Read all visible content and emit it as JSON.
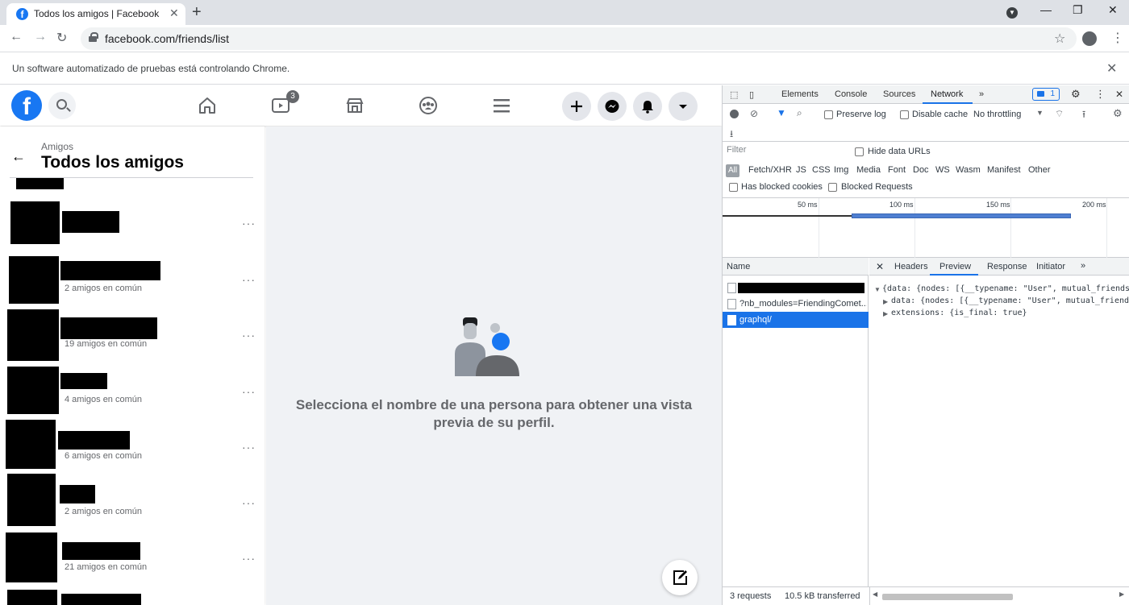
{
  "browser": {
    "tab_title": "Todos los amigos | Facebook",
    "url": "facebook.com/friends/list",
    "infobar_message": "Un software automatizado de pruebas está controlando Chrome."
  },
  "facebook": {
    "watch_badge": "3",
    "breadcrumb": "Amigos",
    "list_title": "Todos los amigos",
    "friends": [
      {
        "mutual": ""
      },
      {
        "mutual": "2 amigos en común"
      },
      {
        "mutual": "19 amigos en común"
      },
      {
        "mutual": "4 amigos en común"
      },
      {
        "mutual": "6 amigos en común"
      },
      {
        "mutual": "2 amigos en común"
      },
      {
        "mutual": "21 amigos en común"
      }
    ],
    "more_options": "···",
    "empty_state": "Selecciona el nombre de una persona para obtener una vista previa de su perfil."
  },
  "devtools": {
    "tabs": [
      "Elements",
      "Console",
      "Sources",
      "Network"
    ],
    "active_tab": "Network",
    "issues_count": "1",
    "preserve_log": "Preserve log",
    "disable_cache": "Disable cache",
    "throttling": "No throttling",
    "filter_placeholder": "Filter",
    "hide_data_urls": "Hide data URLs",
    "type_filters": [
      "All",
      "Fetch/XHR",
      "JS",
      "CSS",
      "Img",
      "Media",
      "Font",
      "Doc",
      "WS",
      "Wasm",
      "Manifest",
      "Other"
    ],
    "has_blocked_cookies": "Has blocked cookies",
    "blocked_requests": "Blocked Requests",
    "timeline_ticks": [
      "50 ms",
      "100 ms",
      "150 ms",
      "200 ms"
    ],
    "name_column": "Name",
    "requests": [
      {
        "name": ""
      },
      {
        "name": "?nb_modules=FriendingComet..."
      },
      {
        "name": "graphql/"
      }
    ],
    "detail_tabs": [
      "Headers",
      "Preview",
      "Response",
      "Initiator"
    ],
    "active_detail_tab": "Preview",
    "preview_lines": [
      "{data: {nodes: [{__typename: \"User\", mutual_friends",
      "data: {nodes: [{__typename: \"User\", mutual_friends",
      "extensions: {is_final: true}"
    ],
    "status_requests": "3 requests",
    "status_transferred": "10.5 kB transferred"
  },
  "colors": {
    "facebook_blue": "#1877f2",
    "devtools_accent": "#1a73e8"
  }
}
